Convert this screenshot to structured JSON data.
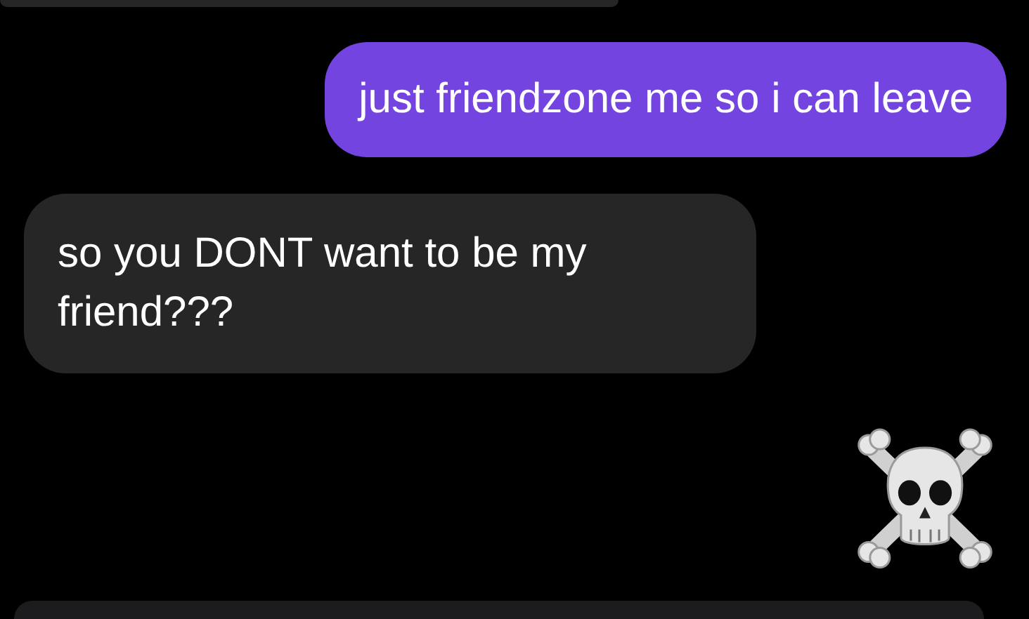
{
  "messages": [
    {
      "kind": "cut_top",
      "sent": false
    },
    {
      "kind": "text",
      "sent": true,
      "text": "just friendzone me so i can leave"
    },
    {
      "kind": "text",
      "sent": false,
      "text": "so you DONT want to be my friend???"
    },
    {
      "kind": "emoji",
      "sent": true
    },
    {
      "kind": "cut_bottom",
      "sent": false
    }
  ]
}
